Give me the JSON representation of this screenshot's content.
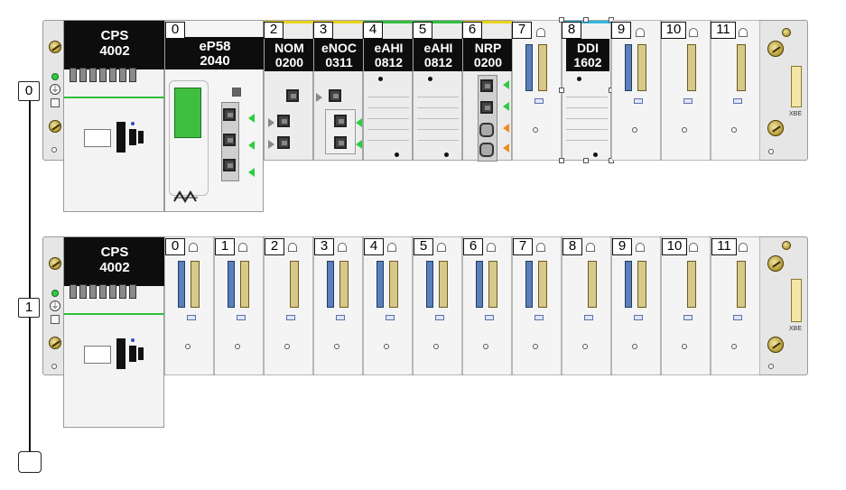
{
  "racks": [
    {
      "index_label": "0",
      "power_supply": {
        "line1": "CPS",
        "line2": "4002"
      },
      "slots": [
        {
          "num": "0",
          "line1": "eP58",
          "line2": "2040",
          "strip": ""
        },
        {
          "num": "2",
          "line1": "NOM",
          "line2": "0200",
          "strip": "#e8d31c"
        },
        {
          "num": "3",
          "line1": "eNOC",
          "line2": "0311",
          "strip": "#e8d31c"
        },
        {
          "num": "4",
          "line1": "eAHI",
          "line2": "0812",
          "strip": "#2fbf3f"
        },
        {
          "num": "5",
          "line1": "eAHI",
          "line2": "0812",
          "strip": "#2fbf3f"
        },
        {
          "num": "6",
          "line1": "NRP",
          "line2": "0200",
          "strip": "#e8d31c"
        },
        {
          "num": "7",
          "line1": "",
          "line2": "",
          "strip": ""
        },
        {
          "num": "8",
          "line1": "DDI",
          "line2": "1602",
          "strip": "#2fb8e0"
        },
        {
          "num": "9",
          "line1": "",
          "line2": "",
          "strip": ""
        },
        {
          "num": "10",
          "line1": "",
          "line2": "",
          "strip": ""
        },
        {
          "num": "11",
          "line1": "",
          "line2": "",
          "strip": ""
        }
      ],
      "xbe_label": "XBE"
    },
    {
      "index_label": "1",
      "power_supply": {
        "line1": "CPS",
        "line2": "4002"
      },
      "slots": [
        {
          "num": "0"
        },
        {
          "num": "1"
        },
        {
          "num": "2"
        },
        {
          "num": "3"
        },
        {
          "num": "4"
        },
        {
          "num": "5"
        },
        {
          "num": "6"
        },
        {
          "num": "7"
        },
        {
          "num": "8"
        },
        {
          "num": "9"
        },
        {
          "num": "10"
        },
        {
          "num": "11"
        }
      ],
      "xbe_label": "XBE"
    }
  ],
  "colors": {
    "backplane": "#e6e6e6",
    "module_head": "#0d0d0d",
    "status_green": "#2ecc40",
    "link_orange": "#f08c1e",
    "strip_yellow": "#e8d31c",
    "strip_cyan": "#2fb8e0"
  },
  "icons": [
    "screw-icon",
    "ground-symbol-icon",
    "ethernet-port-icon",
    "selection-handle-icon"
  ]
}
